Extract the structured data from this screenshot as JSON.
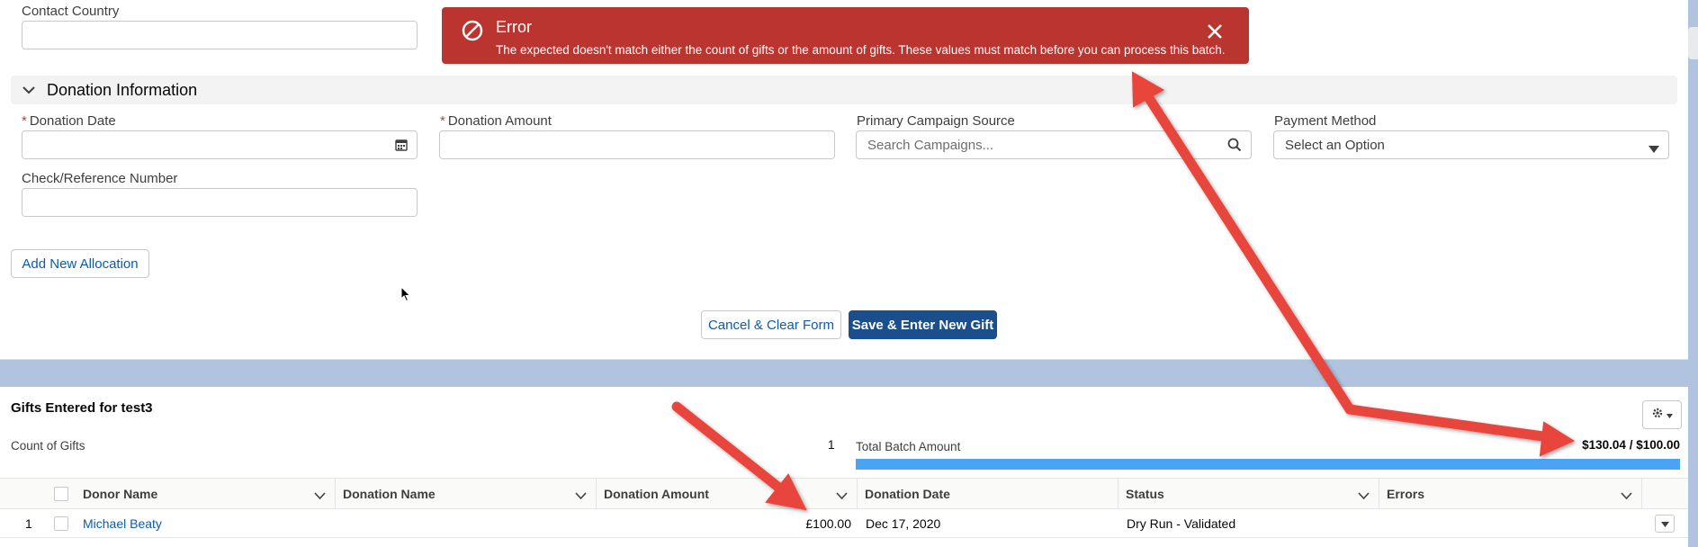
{
  "form": {
    "contact_country_label": "Contact Country",
    "section_title": "Donation Information",
    "donation_date_label": "Donation Date",
    "donation_amount_label": "Donation Amount",
    "required_mark": "*",
    "campaign_label": "Primary Campaign Source",
    "campaign_placeholder": "Search Campaigns...",
    "payment_label": "Payment Method",
    "payment_value": "Select an Option",
    "check_label": "Check/Reference Number",
    "add_allocation_label": "Add New Allocation",
    "cancel_label": "Cancel & Clear Form",
    "save_label": "Save & Enter New Gift"
  },
  "toast": {
    "title": "Error",
    "message": "The expected doesn't match either the count of gifts or the amount of gifts. These values must match before you can process this batch.",
    "color": "#ba3430"
  },
  "gifts": {
    "title": "Gifts Entered for test3",
    "count_label": "Count of Gifts",
    "count_value": "1",
    "total_label": "Total Batch Amount",
    "total_value": "$130.04 / $100.00",
    "progress_fraction": 1.0,
    "columns": [
      "Donor Name",
      "Donation Name",
      "Donation Amount",
      "Donation Date",
      "Status",
      "Errors"
    ],
    "rows": [
      {
        "index": "1",
        "donor_name": "Michael Beaty",
        "donation_name": "",
        "donation_amount": "£100.00",
        "donation_date": "Dec 17, 2020",
        "status": "Dry Run - Validated",
        "errors": ""
      }
    ]
  },
  "colors": {
    "brand": "#1b4e8d",
    "link": "#0b5cab",
    "progress": "#4ba3f3",
    "annotation_arrow": "#e8453c"
  }
}
